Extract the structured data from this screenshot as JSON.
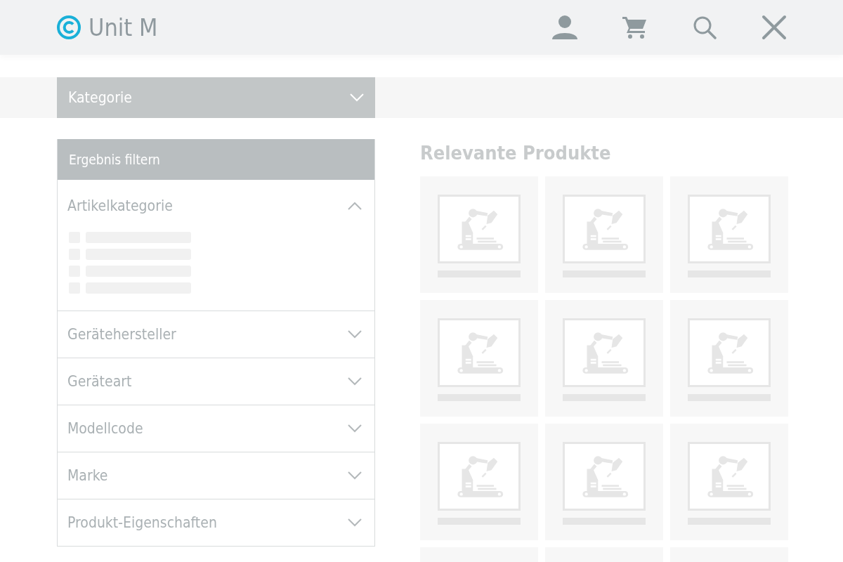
{
  "header": {
    "brand": "Unit M"
  },
  "category_dropdown": {
    "label": "Kategorie",
    "expanded": false
  },
  "filter": {
    "title": "Ergebnis filtern",
    "sections": [
      {
        "label": "Artikelkategorie",
        "expanded": true,
        "options": [
          {
            "kind": "skeleton"
          },
          {
            "kind": "skeleton"
          },
          {
            "kind": "skeleton"
          },
          {
            "kind": "skeleton"
          }
        ]
      },
      {
        "label": "Gerätehersteller",
        "expanded": false
      },
      {
        "label": "Geräteart",
        "expanded": false
      },
      {
        "label": "Modellcode",
        "expanded": false
      },
      {
        "label": "Marke",
        "expanded": false
      },
      {
        "label": "Produkt-Eigenschaften",
        "expanded": false
      }
    ]
  },
  "products": {
    "title": "Relevante Produkte",
    "items": [
      {
        "kind": "placeholder"
      },
      {
        "kind": "placeholder"
      },
      {
        "kind": "placeholder"
      },
      {
        "kind": "placeholder"
      },
      {
        "kind": "placeholder"
      },
      {
        "kind": "placeholder"
      },
      {
        "kind": "placeholder"
      },
      {
        "kind": "placeholder"
      },
      {
        "kind": "placeholder"
      },
      {
        "kind": "cut_off"
      },
      {
        "kind": "cut_off"
      },
      {
        "kind": "cut_off"
      }
    ]
  }
}
